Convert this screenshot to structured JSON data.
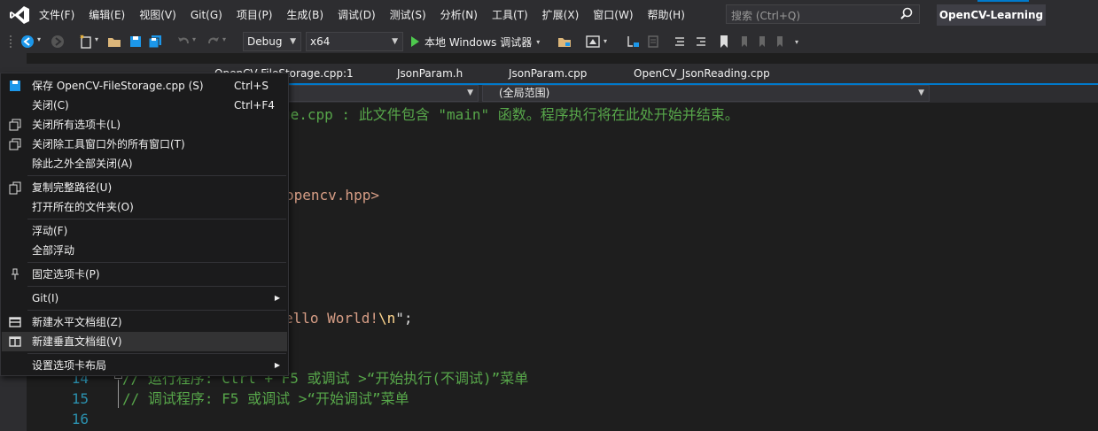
{
  "menubar": {
    "items": [
      "文件(F)",
      "编辑(E)",
      "视图(V)",
      "Git(G)",
      "项目(P)",
      "生成(B)",
      "调试(D)",
      "测试(S)",
      "分析(N)",
      "工具(T)",
      "扩展(X)",
      "窗口(W)",
      "帮助(H)"
    ],
    "search_placeholder": "搜索 (Ctrl+Q)",
    "project_name": "OpenCV-Learning"
  },
  "toolbar": {
    "configuration": "Debug",
    "platform": "x64",
    "run_label": "本地 Windows 调试器"
  },
  "tabs": {
    "items": [
      "OpenCV-FileStorage.cpp:1",
      "JsonParam.h",
      "JsonParam.cpp",
      "OpenCV_JsonReading.cpp"
    ]
  },
  "navbar": {
    "scope": "(全局范围)"
  },
  "editor": {
    "line_comment1": "ge.cpp : 此文件包含 \"main\" 函数。程序执行将在此处开始并结束。",
    "line_include": "opencv.hpp>",
    "line_hello_str": "ello World!",
    "line_hello_esc": "\\n",
    "line_hello_tail": "\";",
    "line14_num": "14",
    "line14_text": "// 运行程序: Ctrl + F5 或调试 >“开始执行(不调试)”菜单",
    "line15_num": "15",
    "line15_text": "// 调试程序: F5 或调试 >“开始调试”菜单",
    "line16_num": "16"
  },
  "context_menu": {
    "save": "保存 OpenCV-FileStorage.cpp (S)",
    "save_shortcut": "Ctrl+S",
    "close": "关闭(C)",
    "close_shortcut": "Ctrl+F4",
    "close_all_tabs": "关闭所有选项卡(L)",
    "close_all_but_tool": "关闭除工具窗口外的所有窗口(T)",
    "close_all_but_this": "除此之外全部关闭(A)",
    "copy_full_path": "复制完整路径(U)",
    "open_containing_folder": "打开所在的文件夹(O)",
    "float": "浮动(F)",
    "float_all": "全部浮动",
    "pin_tab": "固定选项卡(P)",
    "git": "Git(I)",
    "new_horizontal_group": "新建水平文档组(Z)",
    "new_vertical_group": "新建垂直文档组(V)",
    "tab_layout": "设置选项卡布局"
  },
  "colors": {
    "accent": "#007acc",
    "comment": "#57a64a",
    "string": "#d69d85",
    "line_number": "#2b91af"
  }
}
